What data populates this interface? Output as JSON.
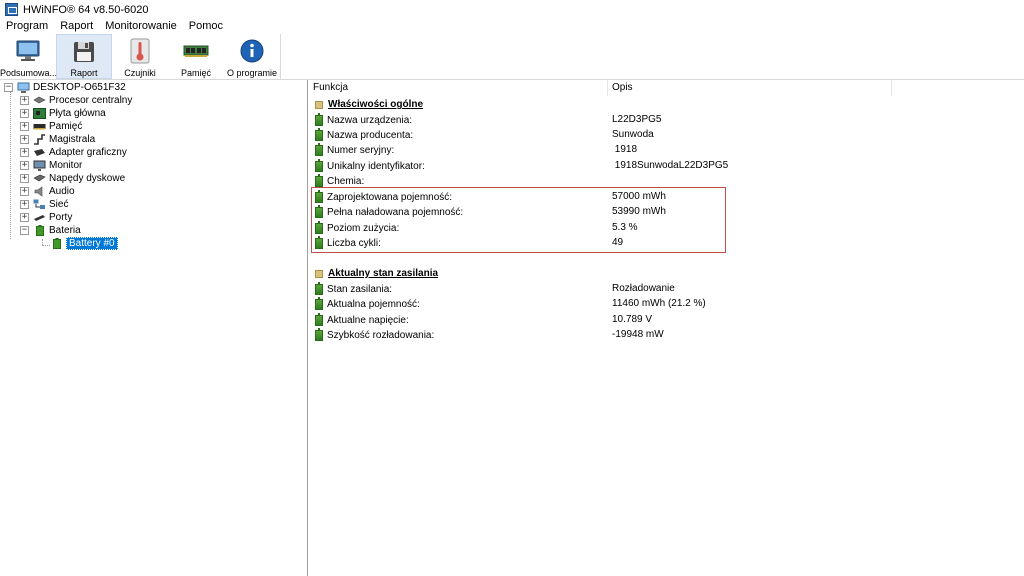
{
  "window": {
    "title": "HWiNFO® 64 v8.50-6020"
  },
  "menu": [
    "Program",
    "Raport",
    "Monitorowanie",
    "Pomoc"
  ],
  "toolbar": [
    {
      "label": "Podsumowa...",
      "icon": "monitor-icon",
      "active": false
    },
    {
      "label": "Raport",
      "icon": "floppy-disk-icon",
      "active": true
    },
    {
      "label": "Czujniki",
      "icon": "thermometer-icon",
      "active": false
    },
    {
      "label": "Pamięć",
      "icon": "memory-module-icon",
      "active": false
    },
    {
      "label": "O programie",
      "icon": "info-icon",
      "active": false
    }
  ],
  "tree": {
    "root": "DESKTOP-O651F32",
    "items": [
      {
        "label": "Procesor centralny",
        "icon": "cpu-icon"
      },
      {
        "label": "Płyta główna",
        "icon": "motherboard-icon"
      },
      {
        "label": "Pamięć",
        "icon": "memory-icon"
      },
      {
        "label": "Magistrala",
        "icon": "bus-icon"
      },
      {
        "label": "Adapter graficzny",
        "icon": "gpu-icon"
      },
      {
        "label": "Monitor",
        "icon": "monitor-icon"
      },
      {
        "label": "Napędy dyskowe",
        "icon": "disk-drive-icon"
      },
      {
        "label": "Audio",
        "icon": "speaker-icon"
      },
      {
        "label": "Sieć",
        "icon": "network-icon"
      },
      {
        "label": "Porty",
        "icon": "ports-icon"
      },
      {
        "label": "Bateria",
        "icon": "battery-icon"
      }
    ],
    "child": "Battery #0"
  },
  "columns": {
    "function": "Funkcja",
    "description": "Opis"
  },
  "sections": [
    {
      "title": "Właściwości ogólne",
      "rows": [
        {
          "label": "Nazwa urządzenia:",
          "value": "L22D3PG5"
        },
        {
          "label": "Nazwa producenta:",
          "value": "Sunwoda"
        },
        {
          "label": "Numer seryjny:",
          "value": " 1918"
        },
        {
          "label": "Unikalny identyfikator:",
          "value": " 1918SunwodaL22D3PG5"
        },
        {
          "label": "Chemia:",
          "value": ""
        },
        {
          "label": "Zaprojektowana pojemność:",
          "value": "57000 mWh"
        },
        {
          "label": "Pełna naładowana pojemność:",
          "value": "53990 mWh"
        },
        {
          "label": "Poziom zużycia:",
          "value": "5.3 %"
        },
        {
          "label": "Liczba cykli:",
          "value": "49"
        }
      ]
    },
    {
      "title": "Aktualny stan zasilania",
      "rows": [
        {
          "label": "Stan zasilania:",
          "value": "Rozładowanie"
        },
        {
          "label": "Aktualna pojemność:",
          "value": "11460 mWh (21.2 %)"
        },
        {
          "label": "Aktualne napięcie:",
          "value": "10.789 V"
        },
        {
          "label": "Szybkość rozładowania:",
          "value": "-19948 mW"
        }
      ]
    }
  ],
  "colors": {
    "selection": "#0078d7",
    "highlight_border": "#c0504d",
    "battery_green": "#3f9a2a"
  }
}
